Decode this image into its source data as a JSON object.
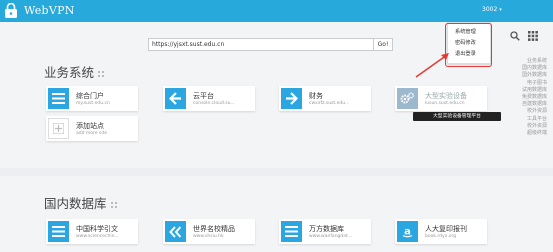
{
  "header": {
    "logo_text": "WebVPN",
    "user": "3002"
  },
  "dropdown": {
    "items": [
      "系统管理",
      "密码修改",
      "退出登录"
    ]
  },
  "search": {
    "value": "https://yjsxt.sust.edu.cn",
    "button_label": "Go!"
  },
  "sections": [
    {
      "title": "业务系统",
      "cards": [
        {
          "title": "综合门户",
          "sub": "my.sust.edu.cn",
          "color": "#2ba6e0",
          "icon": "list"
        },
        {
          "title": "云平台",
          "sub": "console.cloud.su...",
          "color": "#2ba6e0",
          "icon": "arrow-left"
        },
        {
          "title": "财务",
          "sub": "cwxxfz.sust.edu...",
          "color": "#2ba6e0",
          "icon": "arrow-right"
        },
        {
          "title": "大型实验设备",
          "sub": "lusun.sust.edu.cn",
          "color": "#9bb8cc",
          "icon": "gears"
        },
        {
          "title": "添加站点",
          "sub": "add more site",
          "color": "#ffffff",
          "icon": "plus"
        }
      ]
    },
    {
      "title": "国内数据库",
      "cards": [
        {
          "title": "中国科学引文",
          "sub": "www.sciencechin...",
          "color": "#2ba6e0",
          "icon": "list"
        },
        {
          "title": "世界名校精品",
          "sub": "www.shsiu.hk",
          "color": "#2ba6e0",
          "icon": "double-left"
        },
        {
          "title": "万方数据库",
          "sub": "www.wanfangdat...",
          "color": "#2ba6e0",
          "icon": "list"
        },
        {
          "title": "人大复印报刊",
          "sub": "book.rdyx.org",
          "color": "#2ba6e0",
          "icon": "amazon-a"
        }
      ]
    }
  ],
  "tooltip": "大型实验设备管理平台",
  "right_nav": [
    "业务系统",
    "国内数据库",
    "国外数据库",
    "电子图书",
    "试用数据库",
    "免费数据库",
    "自建数据库",
    "校外资源",
    "工具平台",
    "校外资源",
    "超级终端"
  ]
}
